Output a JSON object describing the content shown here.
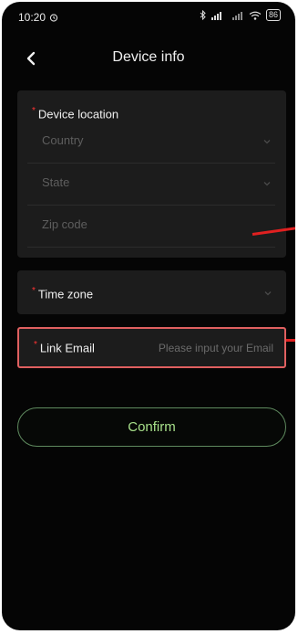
{
  "status_bar": {
    "time": "10:20",
    "alarm_icon": "alarm-clock-icon",
    "signal_text": "ᵢ ⁴ᴳ",
    "battery": "86"
  },
  "header": {
    "back_icon": "chevron-left-icon",
    "title": "Device info"
  },
  "device_location": {
    "label": "Device location",
    "fields": [
      {
        "placeholder": "Country"
      },
      {
        "placeholder": "State"
      },
      {
        "placeholder": "Zip code"
      }
    ]
  },
  "time_zone": {
    "label": "Time zone"
  },
  "link_email": {
    "label": "Link Email",
    "placeholder": "Please input your Email",
    "value": ""
  },
  "confirm": {
    "label": "Confirm"
  },
  "colors": {
    "background": "#050505",
    "card": "#1c1c1c",
    "required": "#ff3333",
    "accent_green": "#a7e08a",
    "highlight_red": "#e06060"
  }
}
